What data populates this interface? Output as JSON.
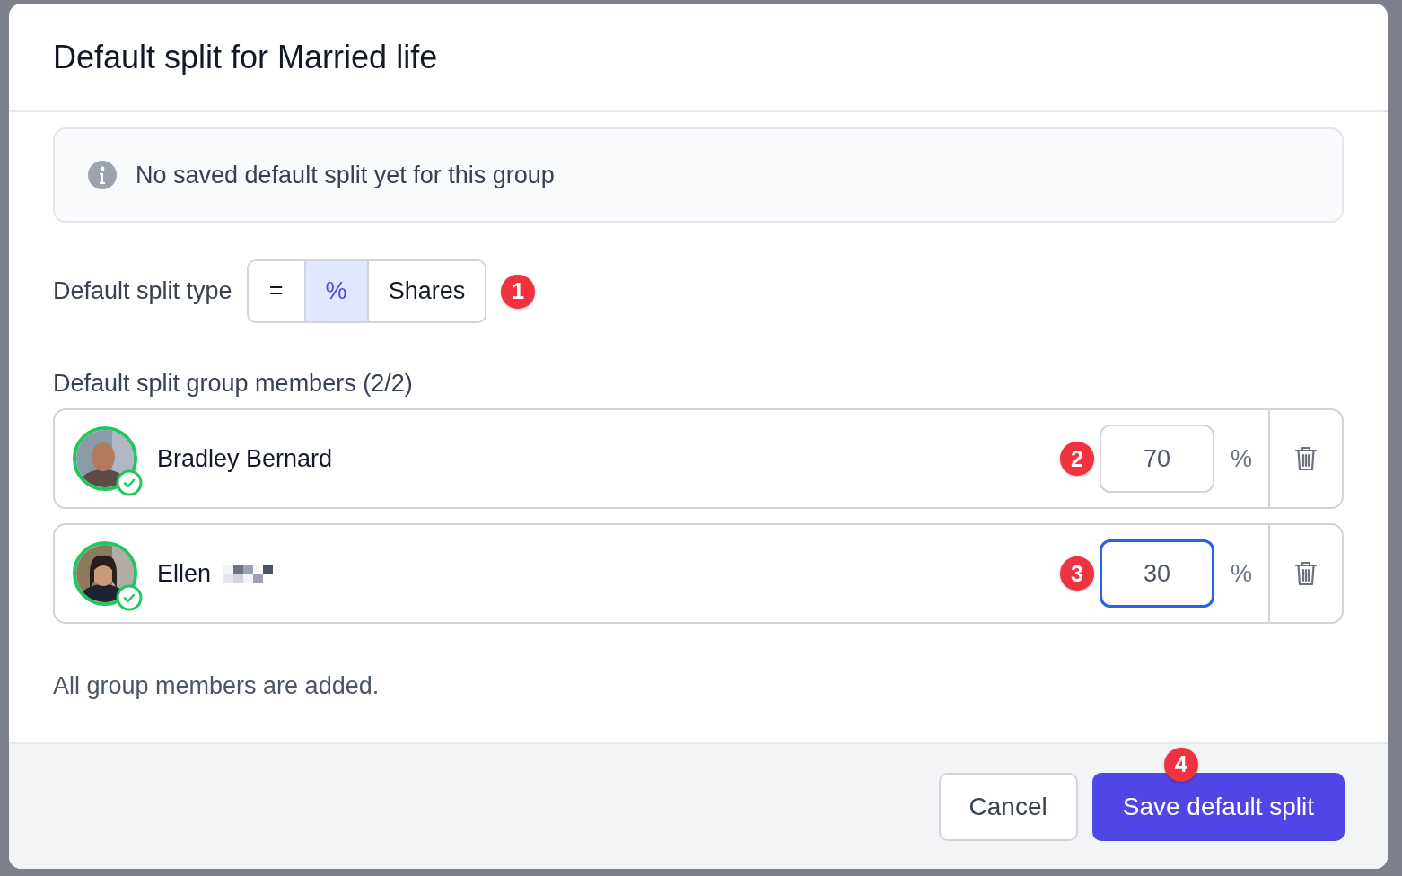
{
  "dialog": {
    "title": "Default split for Married life"
  },
  "notice": {
    "text": "No saved default split yet for this group"
  },
  "split_type": {
    "label": "Default split type",
    "options": [
      {
        "label": "=",
        "selected": false
      },
      {
        "label": "%",
        "selected": true
      },
      {
        "label": "Shares",
        "selected": false
      }
    ],
    "badge": "1"
  },
  "members": {
    "heading": "Default split group members (2/2)",
    "items": [
      {
        "name": "Bradley Bernard",
        "redacted": false,
        "verified": true,
        "value": "70",
        "unit": "%",
        "focused": false,
        "badge": "2"
      },
      {
        "name": "Ellen",
        "redacted": true,
        "verified": true,
        "value": "30",
        "unit": "%",
        "focused": true,
        "badge": "3"
      }
    ],
    "note": "All group members are added."
  },
  "footer": {
    "cancel": "Cancel",
    "save": "Save default split",
    "badge": "4"
  }
}
